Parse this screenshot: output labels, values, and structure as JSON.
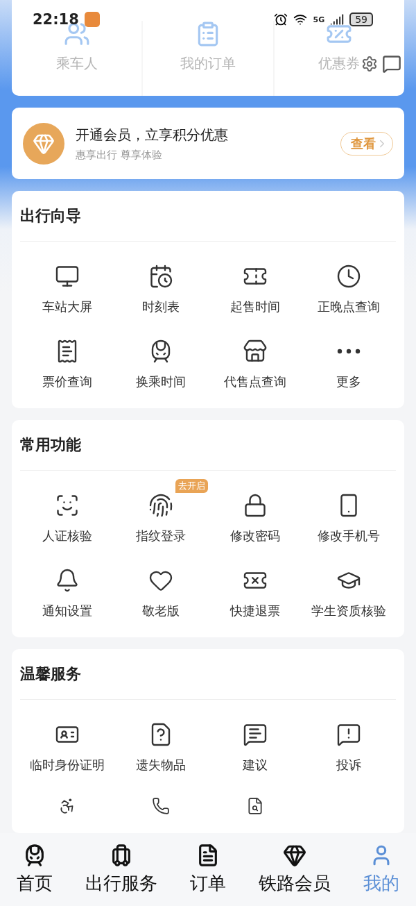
{
  "status_bar": {
    "time": "22:18",
    "network": "5G",
    "battery": "59"
  },
  "shortcuts": [
    {
      "label": "乘车人"
    },
    {
      "label": "我的订单"
    },
    {
      "label": "优惠券"
    }
  ],
  "member_banner": {
    "title": "开通会员，立享积分优惠",
    "subtitle": "惠享出行 尊享体验",
    "button": "查看"
  },
  "sections": [
    {
      "title": "出行向导",
      "items": [
        {
          "label": "车站大屏"
        },
        {
          "label": "时刻表"
        },
        {
          "label": "起售时间"
        },
        {
          "label": "正晚点查询"
        },
        {
          "label": "票价查询"
        },
        {
          "label": "换乘时间"
        },
        {
          "label": "代售点查询"
        },
        {
          "label": "更多"
        }
      ]
    },
    {
      "title": "常用功能",
      "items": [
        {
          "label": "人证核验"
        },
        {
          "label": "指纹登录",
          "badge": "去开启"
        },
        {
          "label": "修改密码"
        },
        {
          "label": "修改手机号"
        },
        {
          "label": "通知设置"
        },
        {
          "label": "敬老版"
        },
        {
          "label": "快捷退票"
        },
        {
          "label": "学生资质核验"
        }
      ]
    },
    {
      "title": "温馨服务",
      "items": [
        {
          "label": "临时身份证明"
        },
        {
          "label": "遗失物品"
        },
        {
          "label": "建议"
        },
        {
          "label": "投诉"
        },
        {
          "kind": "cut"
        },
        {
          "kind": "cut"
        },
        {
          "kind": "cut"
        }
      ]
    }
  ],
  "bottom_nav": [
    {
      "label": "首页",
      "selected": false
    },
    {
      "label": "出行服务",
      "selected": false
    },
    {
      "label": "订单",
      "selected": false
    },
    {
      "label": "铁路会员",
      "selected": false
    },
    {
      "label": "我的",
      "selected": true
    }
  ]
}
